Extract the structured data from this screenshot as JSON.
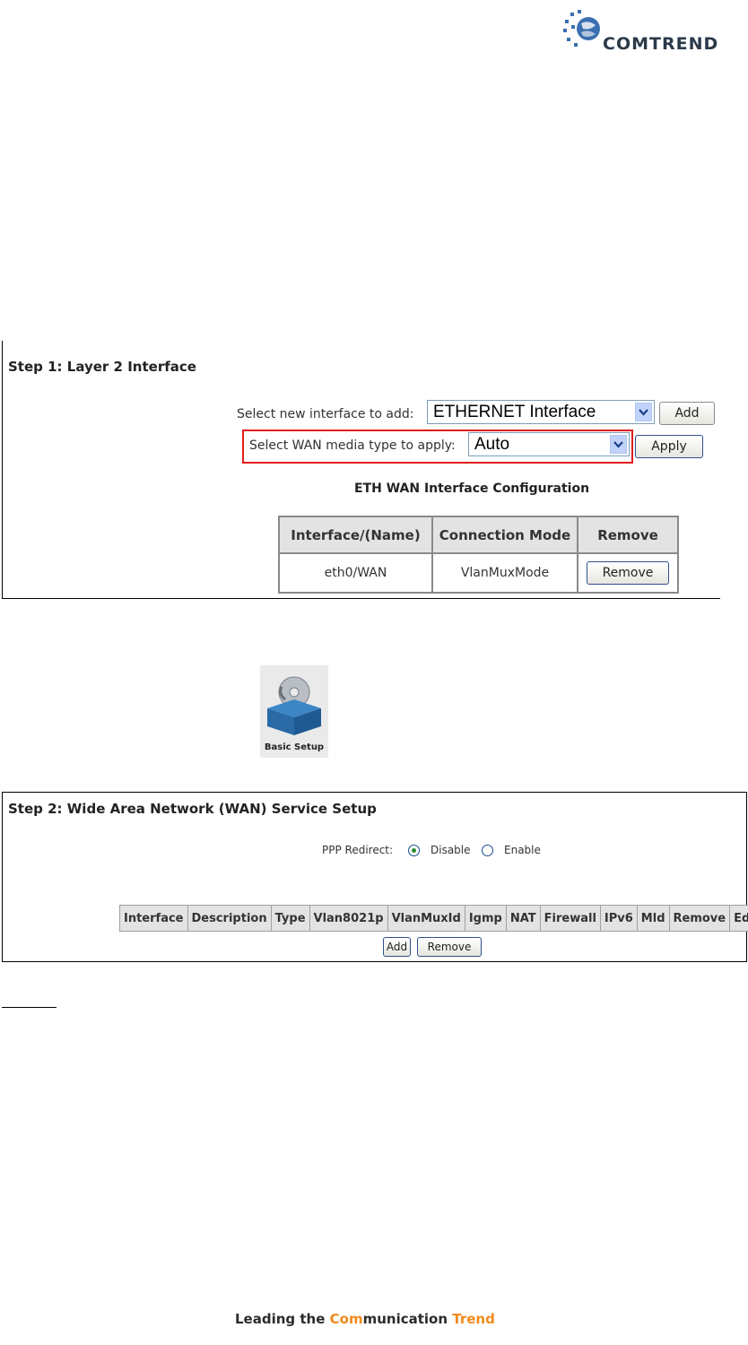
{
  "logo": {
    "brand": "COMTREND"
  },
  "step1": {
    "title": "Step 1: Layer 2 Interface",
    "add_label": "Select new interface to add:",
    "add_select_value": "ETHERNET Interface",
    "add_button": "Add",
    "wan_label": "Select WAN media type to apply:",
    "wan_select_value": "Auto",
    "apply_button": "Apply",
    "table_title": "ETH WAN Interface Configuration",
    "headers": [
      "Interface/(Name)",
      "Connection Mode",
      "Remove"
    ],
    "row": {
      "interface": "eth0/WAN",
      "mode": "VlanMuxMode",
      "remove_button": "Remove"
    }
  },
  "basic_setup": {
    "caption": "Basic Setup"
  },
  "step2": {
    "title": "Step 2: Wide Area Network (WAN) Service Setup",
    "ppp_label": "PPP Redirect:",
    "disable_label": "Disable",
    "enable_label": "Enable",
    "ppp_selected": "Disable",
    "headers": [
      "Interface",
      "Description",
      "Type",
      "Vlan8021p",
      "VlanMuxId",
      "Igmp",
      "NAT",
      "Firewall",
      "IPv6",
      "Mld",
      "Remove",
      "Edit"
    ],
    "add_button": "Add",
    "remove_button": "Remove"
  },
  "footer": {
    "part1": "Leading the ",
    "accent1": "Com",
    "part2": "munication ",
    "accent2": "Trend"
  },
  "colors": {
    "highlight_box": "#e21d1d",
    "footer_accent": "#f08a1c",
    "header_bg": "#e3e3e3"
  }
}
